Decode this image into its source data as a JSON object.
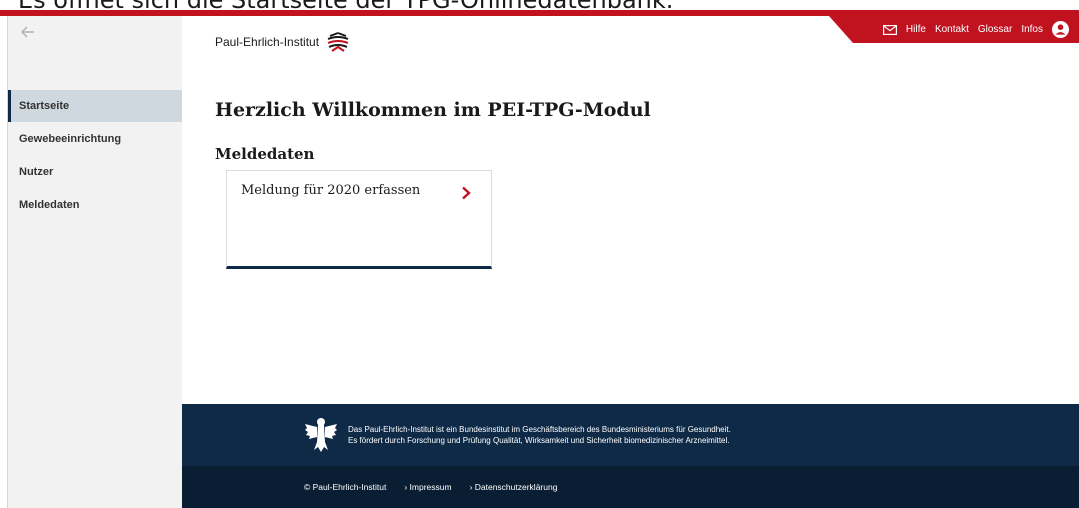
{
  "caption": "Es öffnet sich die Startseite der TPG-Onlinedatenbank.",
  "header": {
    "logo_text": "Paul-Ehrlich-Institut",
    "topnav": [
      "Hilfe",
      "Kontakt",
      "Glossar",
      "Infos"
    ]
  },
  "sidebar": {
    "items": [
      {
        "label": "Startseite",
        "active": true
      },
      {
        "label": "Gewebeeinrichtung",
        "active": false
      },
      {
        "label": "Nutzer",
        "active": false
      },
      {
        "label": "Meldedaten",
        "active": false
      }
    ]
  },
  "main": {
    "title": "Herzlich Willkommen im PEI-TPG-Modul",
    "section_title": "Meldedaten",
    "card_label": "Meldung für 2020 erfassen"
  },
  "footer": {
    "line1": "Das Paul-Ehrlich-Institut ist ein Bundesinstitut im Geschäftsbereich des Bundesministeriums für Gesundheit.",
    "line2": "Es fördert durch Forschung und Prüfung Qualität, Wirksamkeit und Sicherheit biomedizinischer Arzneimittel.",
    "copyright": "© Paul-Ehrlich-Institut",
    "links": [
      "› Impressum",
      "› Datenschutzerklärung"
    ]
  },
  "colors": {
    "brand_red": "#c1121f",
    "navy": "#0e2a47",
    "sidebar_bg": "#f2f2f2",
    "active_item_bg": "#cfd8df"
  },
  "icons": [
    "back-arrow-icon",
    "logo-mark-icon",
    "mail-icon",
    "user-account-icon",
    "chevron-right-icon",
    "federal-eagle-icon"
  ]
}
